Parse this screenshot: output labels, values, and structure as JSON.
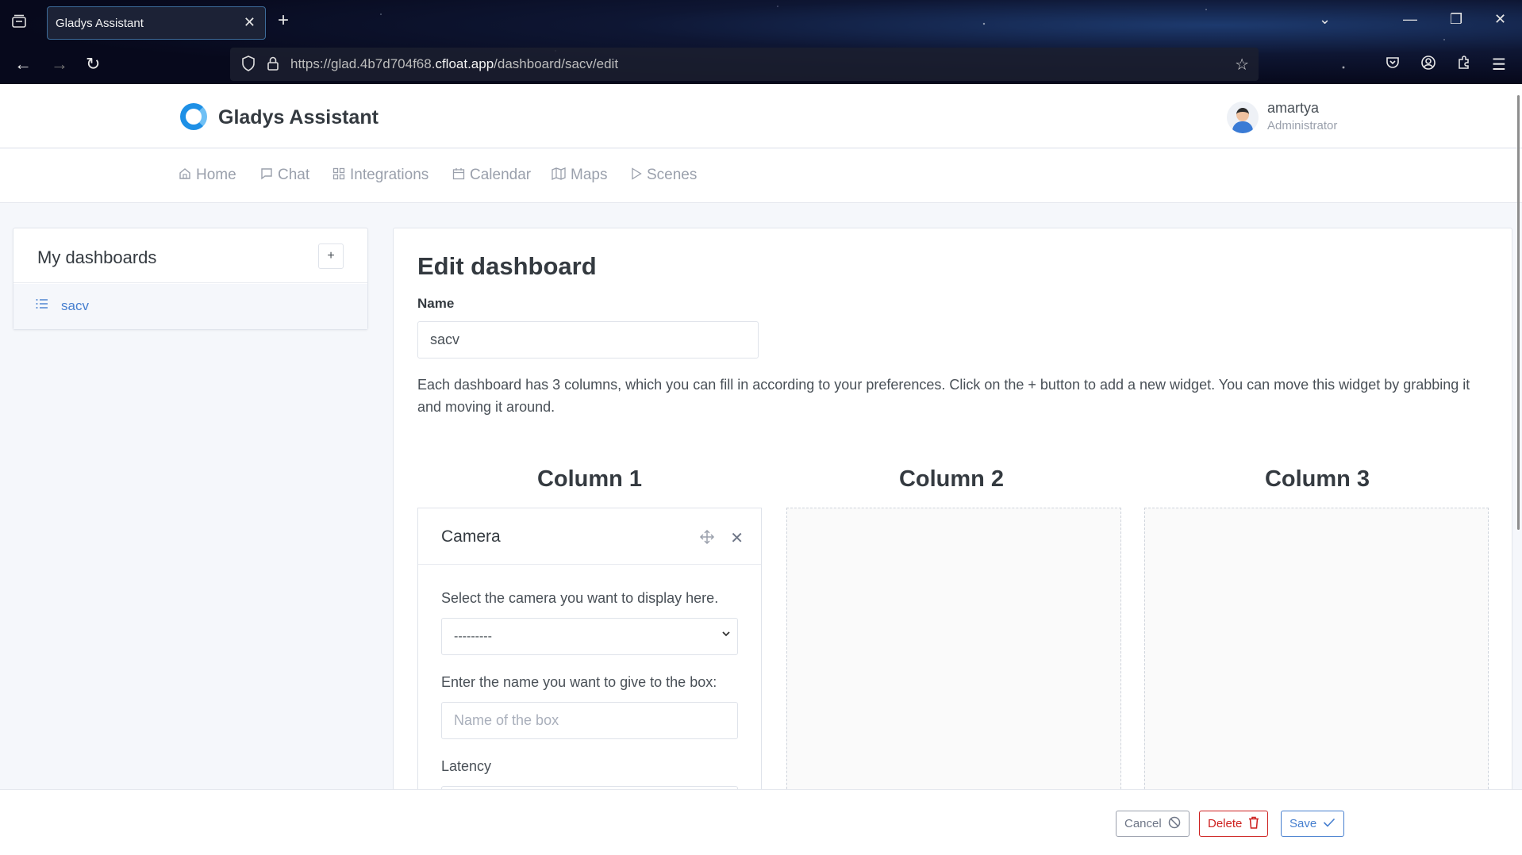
{
  "browser": {
    "tab_title": "Gladys Assistant",
    "url_prefix": "https://glad.4b7d704f68.",
    "url_domain": "cfloat.app",
    "url_path": "/dashboard/sacv/edit"
  },
  "header": {
    "brand": "Gladys Assistant",
    "user_name": "amartya",
    "user_role": "Administrator"
  },
  "nav": {
    "home": "Home",
    "chat": "Chat",
    "integrations": "Integrations",
    "calendar": "Calendar",
    "maps": "Maps",
    "scenes": "Scenes"
  },
  "sidebar": {
    "title": "My dashboards",
    "add_label": "+",
    "items": [
      {
        "label": "sacv"
      }
    ]
  },
  "editor": {
    "title": "Edit dashboard",
    "name_label": "Name",
    "name_value": "sacv",
    "description": "Each dashboard has 3 columns, which you can fill in according to your preferences. Click on the + button to add a new widget. You can move this widget by grabbing it and moving it around.",
    "columns": [
      {
        "title": "Column 1"
      },
      {
        "title": "Column 2"
      },
      {
        "title": "Column 3"
      }
    ],
    "widget": {
      "title": "Camera",
      "camera_label": "Select the camera you want to display here.",
      "camera_selected": "---------",
      "box_name_label": "Enter the name you want to give to the box:",
      "box_name_placeholder": "Name of the box",
      "latency_label": "Latency"
    }
  },
  "footer": {
    "cancel": "Cancel",
    "delete": "Delete",
    "save": "Save"
  },
  "colors": {
    "accent": "#467fcf",
    "danger": "#cd201f",
    "muted": "#9aa0ac"
  }
}
